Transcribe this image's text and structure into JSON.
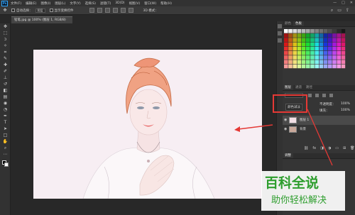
{
  "app": {
    "logo": "Ps",
    "window_controls": [
      "—",
      "□",
      "✕"
    ]
  },
  "menu": [
    "文件(F)",
    "编辑(E)",
    "图像(I)",
    "图层(L)",
    "文字(Y)",
    "选择(S)",
    "滤镜(T)",
    "3D(D)",
    "视图(V)",
    "窗口(W)",
    "帮助(H)"
  ],
  "options": {
    "auto_select_label": "自动选择：",
    "auto_select_value": "图层",
    "transform_label": "显示变换控件",
    "mode_label": "3D 模式："
  },
  "document": {
    "tab_title": "铅笔.jpg @ 100% (图层 1, RGB/8)"
  },
  "panels": {
    "top_tabs": [
      "颜色",
      "色板"
    ],
    "bottom_tabs": [
      "图层",
      "通道",
      "路径"
    ],
    "opacity_label": "不透明度：",
    "opacity_value": "100%",
    "fill_label": "填充：",
    "fill_value": "100%",
    "blend_mode": "颜色减淡",
    "layers": [
      {
        "name": "图层 1"
      },
      {
        "name": "背景"
      }
    ],
    "properties_tab": "调整"
  },
  "watermark": {
    "title": "百科全说",
    "subtitle": "助你轻松解决"
  },
  "colors": {
    "accent_red": "#e53935",
    "watermark_green": "#2e9e2e",
    "ps_blue": "#31a8ff"
  }
}
